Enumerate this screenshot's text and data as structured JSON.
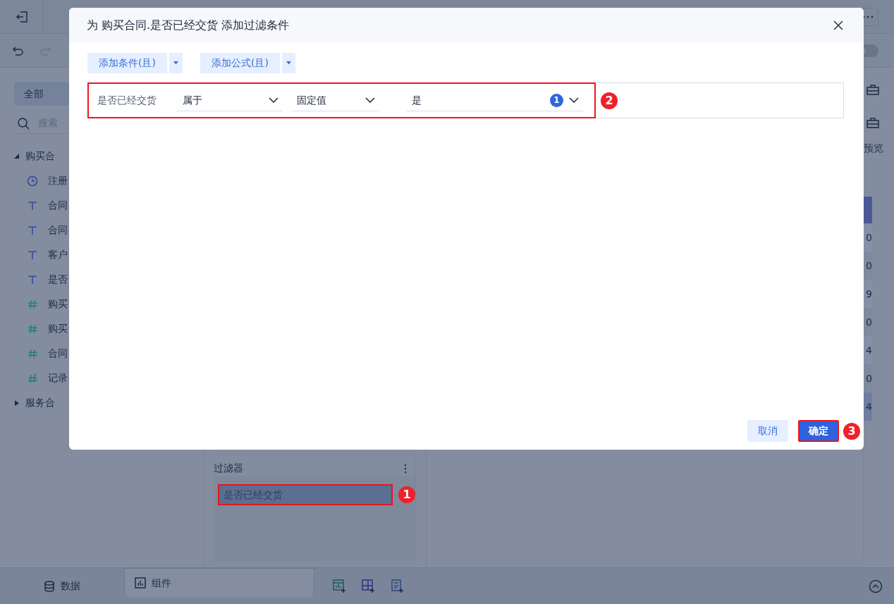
{
  "app": {
    "toolbar": {
      "toggle": {
        "on": false
      }
    },
    "sidebar": {
      "tabs": [
        {
          "label": "全部",
          "selected": true
        }
      ],
      "search": {
        "placeholder": "搜索"
      },
      "tree": [
        {
          "label": "购买合",
          "expanded": true,
          "children": [
            {
              "label": "注册",
              "kind": "date"
            },
            {
              "label": "合同",
              "kind": "text"
            },
            {
              "label": "合同",
              "kind": "text"
            },
            {
              "label": "客户",
              "kind": "text"
            },
            {
              "label": "是否",
              "kind": "text"
            },
            {
              "label": "购买",
              "kind": "number"
            },
            {
              "label": "购买",
              "kind": "number"
            },
            {
              "label": "合同",
              "kind": "number"
            },
            {
              "label": "记录",
              "kind": "calc"
            }
          ]
        },
        {
          "label": "服务合",
          "expanded": false
        }
      ]
    },
    "filter_panel": {
      "title": "过滤器",
      "items": [
        {
          "label": "是否已经交货",
          "highlighted": true,
          "callout": "1"
        }
      ]
    },
    "preview": {
      "label": "预览",
      "table_column": [
        "0",
        "0",
        "9",
        "0",
        "4",
        "0",
        "4"
      ]
    },
    "bottom_bar": {
      "tabs": [
        {
          "label": "数据",
          "selected": false,
          "kind": "data"
        },
        {
          "label": "组件",
          "selected": true,
          "kind": "component"
        }
      ]
    }
  },
  "dialog": {
    "title": "为 购买合同.是否已经交货 添加过滤条件",
    "add_buttons": [
      {
        "label": "添加条件(且)"
      },
      {
        "label": "添加公式(且)"
      }
    ],
    "condition": {
      "field": "是否已经交货",
      "operator": "属于",
      "value_type": "固定值",
      "value": "是",
      "count": "1",
      "highlighted": true,
      "callout": "2"
    },
    "buttons": [
      {
        "label": "取消",
        "kind": "secondary",
        "highlighted": false
      },
      {
        "label": "确定",
        "kind": "primary",
        "highlighted": true,
        "callout": "3"
      }
    ]
  }
}
